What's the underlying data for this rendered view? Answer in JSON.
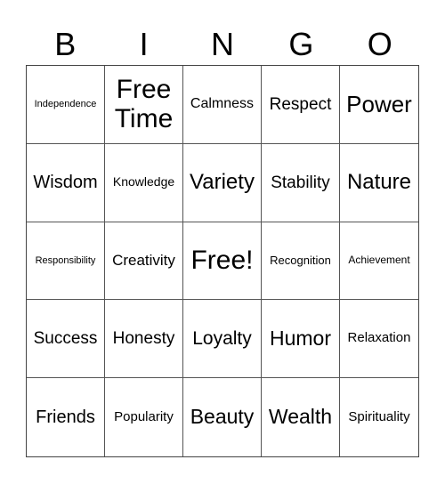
{
  "header": [
    "B",
    "I",
    "N",
    "G",
    "O"
  ],
  "cells": [
    "Independence",
    "Free Time",
    "Calmness",
    "Respect",
    "Power",
    "Wisdom",
    "Knowledge",
    "Variety",
    "Stability",
    "Nature",
    "Responsibility",
    "Creativity",
    "Free!",
    "Recognition",
    "Achievement",
    "Success",
    "Honesty",
    "Loyalty",
    "Humor",
    "Relaxation",
    "Friends",
    "Popularity",
    "Beauty",
    "Wealth",
    "Spirituality"
  ]
}
